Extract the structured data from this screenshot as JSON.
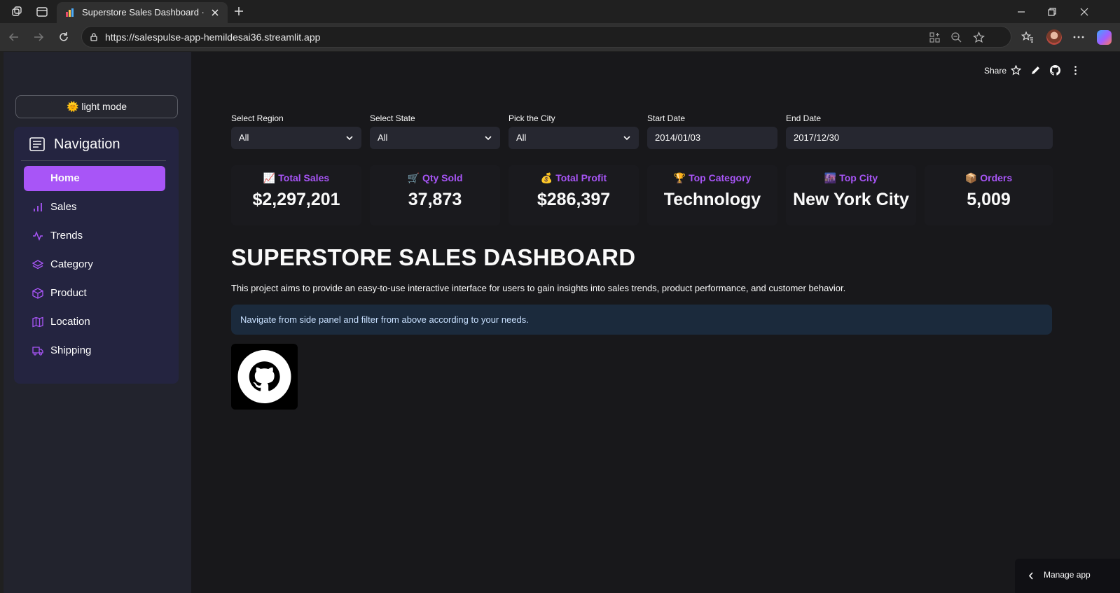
{
  "browser": {
    "tab_title": "Superstore Sales Dashboard · Stre",
    "url": "https://salespulse-app-hemildesai36.streamlit.app"
  },
  "sidebar": {
    "mode_button": "light mode",
    "mode_emoji": "🌞",
    "nav_title": "Navigation",
    "items": [
      {
        "label": "Home",
        "icon": "home"
      },
      {
        "label": "Sales",
        "icon": "bar-chart-icon"
      },
      {
        "label": "Trends",
        "icon": "activity-icon"
      },
      {
        "label": "Category",
        "icon": "layers-icon"
      },
      {
        "label": "Product",
        "icon": "box-icon"
      },
      {
        "label": "Location",
        "icon": "map-icon"
      },
      {
        "label": "Shipping",
        "icon": "truck-icon"
      }
    ],
    "accent": "#a855f7"
  },
  "header": {
    "share": "Share"
  },
  "filters": [
    {
      "label": "Select Region",
      "value": "All"
    },
    {
      "label": "Select State",
      "value": "All"
    },
    {
      "label": "Pick the City",
      "value": "All"
    },
    {
      "label": "Start Date",
      "value": "2014/01/03"
    },
    {
      "label": "End Date",
      "value": "2017/12/30"
    }
  ],
  "metrics": [
    {
      "emoji": "📈",
      "label": "Total Sales",
      "value": "$2,297,201"
    },
    {
      "emoji": "🛒",
      "label": "Qty Sold",
      "value": "37,873"
    },
    {
      "emoji": "💰",
      "label": "Total Profit",
      "value": "$286,397"
    },
    {
      "emoji": "🏆",
      "label": "Top Category",
      "value": "Technology"
    },
    {
      "emoji": "🌆",
      "label": "Top City",
      "value": "New York City"
    },
    {
      "emoji": "📦",
      "label": "Orders",
      "value": "5,009"
    }
  ],
  "main": {
    "title": "SUPERSTORE SALES DASHBOARD",
    "description": "This project aims to provide an easy-to-use interactive interface for users to gain insights into sales trends, product performance, and customer behavior.",
    "info": "Navigate from side panel and filter from above according to your needs."
  },
  "footer": {
    "manage_app": "Manage app"
  }
}
